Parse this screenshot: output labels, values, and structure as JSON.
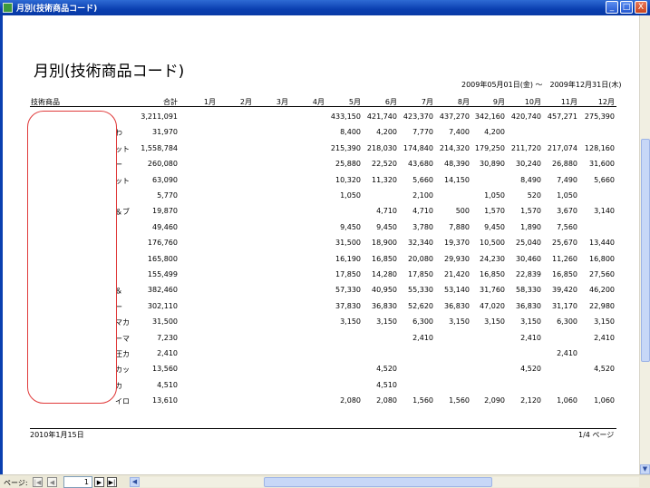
{
  "window": {
    "title": "月別(技術商品コード)",
    "buttons": {
      "minimize": "_",
      "maximize": "□",
      "close": "X"
    }
  },
  "report": {
    "title": "月別(技術商品コード)",
    "date_range": "2009年05月01日(金) ～　2009年12月31日(木)",
    "columns": [
      "技術商品",
      "合計",
      "1月",
      "2月",
      "3月",
      "4月",
      "5月",
      "6月",
      "7月",
      "8月",
      "9月",
      "10月",
      "11月",
      "12月"
    ],
    "rows": [
      {
        "name": "",
        "total": "3,211,091",
        "m5": "433,150",
        "m6": "421,740",
        "m7": "423,370",
        "m8": "437,270",
        "m9": "342,160",
        "m10": "420,740",
        "m11": "457,271",
        "m12": "275,390"
      },
      {
        "name": "わ",
        "total": "31,970",
        "m5": "8,400",
        "m6": "4,200",
        "m7": "7,770",
        "m8": "7,400",
        "m9": "4,200",
        "m10": "",
        "m11": "",
        "m12": ""
      },
      {
        "name": "ット",
        "total": "1,558,784",
        "m5": "215,390",
        "m6": "218,030",
        "m7": "174,840",
        "m8": "214,320",
        "m9": "179,250",
        "m10": "211,720",
        "m11": "217,074",
        "m12": "128,160"
      },
      {
        "name": "ー",
        "total": "260,080",
        "m5": "25,880",
        "m6": "22,520",
        "m7": "43,680",
        "m8": "48,390",
        "m9": "30,890",
        "m10": "30,240",
        "m11": "26,880",
        "m12": "31,600"
      },
      {
        "name": "ット",
        "total": "63,090",
        "m5": "10,320",
        "m6": "11,320",
        "m7": "5,660",
        "m8": "14,150",
        "m9": "",
        "m10": "8,490",
        "m11": "7,490",
        "m12": "5,660"
      },
      {
        "name": "",
        "total": "5,770",
        "m5": "1,050",
        "m6": "",
        "m7": "2,100",
        "m8": "",
        "m9": "1,050",
        "m10": "520",
        "m11": "1,050",
        "m12": ""
      },
      {
        "name": "＆ブ",
        "total": "19,870",
        "m5": "",
        "m6": "4,710",
        "m7": "4,710",
        "m8": "500",
        "m9": "1,570",
        "m10": "1,570",
        "m11": "3,670",
        "m12": "3,140"
      },
      {
        "name": "",
        "total": "49,460",
        "m5": "9,450",
        "m6": "9,450",
        "m7": "3,780",
        "m8": "7,880",
        "m9": "9,450",
        "m10": "1,890",
        "m11": "7,560",
        "m12": ""
      },
      {
        "name": "",
        "total": "176,760",
        "m5": "31,500",
        "m6": "18,900",
        "m7": "32,340",
        "m8": "19,370",
        "m9": "10,500",
        "m10": "25,040",
        "m11": "25,670",
        "m12": "13,440"
      },
      {
        "name": "",
        "total": "165,800",
        "m5": "16,190",
        "m6": "16,850",
        "m7": "20,080",
        "m8": "29,930",
        "m9": "24,230",
        "m10": "30,460",
        "m11": "11,260",
        "m12": "16,800"
      },
      {
        "name": "",
        "total": "155,499",
        "m5": "17,850",
        "m6": "14,280",
        "m7": "17,850",
        "m8": "21,420",
        "m9": "16,850",
        "m10": "22,839",
        "m11": "16,850",
        "m12": "27,560"
      },
      {
        "name": "＆",
        "total": "382,460",
        "m5": "57,330",
        "m6": "40,950",
        "m7": "55,330",
        "m8": "53,140",
        "m9": "31,760",
        "m10": "58,330",
        "m11": "39,420",
        "m12": "46,200"
      },
      {
        "name": "ー",
        "total": "302,110",
        "m5": "37,830",
        "m6": "36,830",
        "m7": "52,620",
        "m8": "36,830",
        "m9": "47,020",
        "m10": "36,830",
        "m11": "31,170",
        "m12": "22,980"
      },
      {
        "name": "マカ",
        "total": "31,500",
        "m5": "3,150",
        "m6": "3,150",
        "m7": "6,300",
        "m8": "3,150",
        "m9": "3,150",
        "m10": "3,150",
        "m11": "6,300",
        "m12": "3,150"
      },
      {
        "name": "ーマ",
        "total": "7,230",
        "m5": "",
        "m6": "",
        "m7": "2,410",
        "m8": "",
        "m9": "",
        "m10": "2,410",
        "m11": "",
        "m12": "2,410"
      },
      {
        "name": "圧カ",
        "total": "2,410",
        "m5": "",
        "m6": "",
        "m7": "",
        "m8": "",
        "m9": "",
        "m10": "",
        "m11": "2,410",
        "m12": ""
      },
      {
        "name": "カッ",
        "total": "13,560",
        "m5": "",
        "m6": "4,520",
        "m7": "",
        "m8": "",
        "m9": "",
        "m10": "4,520",
        "m11": "",
        "m12": "4,520"
      },
      {
        "name": "カ",
        "total": "4,510",
        "m5": "",
        "m6": "4,510",
        "m7": "",
        "m8": "",
        "m9": "",
        "m10": "",
        "m11": "",
        "m12": ""
      },
      {
        "name": "イロ",
        "total": "13,610",
        "m5": "2,080",
        "m6": "2,080",
        "m7": "1,560",
        "m8": "1,560",
        "m9": "2,090",
        "m10": "2,120",
        "m11": "1,060",
        "m12": "1,060"
      }
    ],
    "footer_date": "2010年1月15日",
    "footer_page": "1/4 ページ"
  },
  "statusbar": {
    "label": "ページ:",
    "page_value": "1",
    "nav": {
      "first": "|◀",
      "prev": "◀",
      "next": "▶",
      "last": "▶|"
    }
  },
  "colors": {
    "titlebar": "#0a3fb0",
    "redaction": "#e03a3a"
  }
}
